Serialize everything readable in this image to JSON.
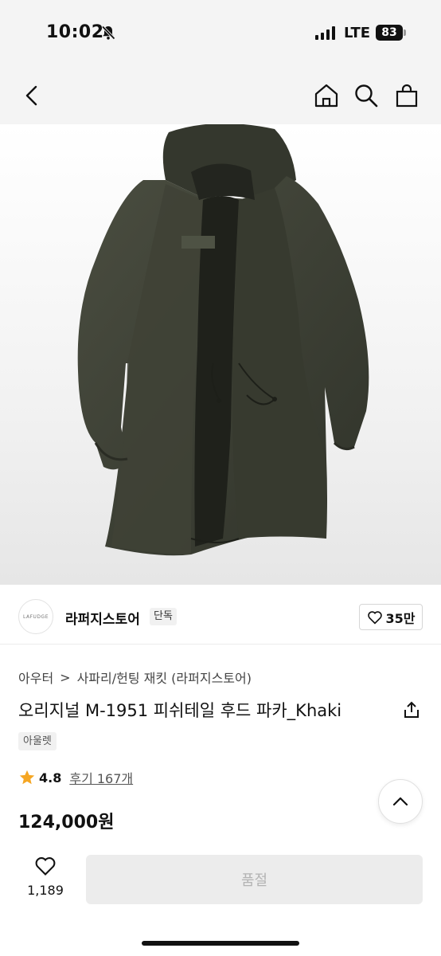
{
  "status_bar": {
    "time": "10:02",
    "network": "LTE",
    "battery": "83"
  },
  "nav": {
    "back_icon": "chevron-left-icon",
    "home_icon": "home-icon",
    "search_icon": "search-icon",
    "cart_icon": "shopping-bag-icon"
  },
  "product_image": {
    "icon": "khaki-parka-photo"
  },
  "seller": {
    "logo_text": "LAFUDGE",
    "name": "라퍼지스토어",
    "badge": "단독",
    "like_count": "35만"
  },
  "breadcrumb": {
    "category": "아우터",
    "separator": ">",
    "subcategory": "사파리/헌팅 재킷 (라퍼지스토어)"
  },
  "product": {
    "title": "오리지널 M-1951 피쉬테일 후드 파카_Khaki",
    "tag": "아울렛",
    "rating": "4.8",
    "reviews": "후기 167개",
    "price": "124,000원"
  },
  "bottom_bar": {
    "like_count": "1,189",
    "buy_label": "품절"
  },
  "colors": {
    "star": "#f5a623",
    "coat": "#3c3f33",
    "disabled_button": "#ececec"
  }
}
